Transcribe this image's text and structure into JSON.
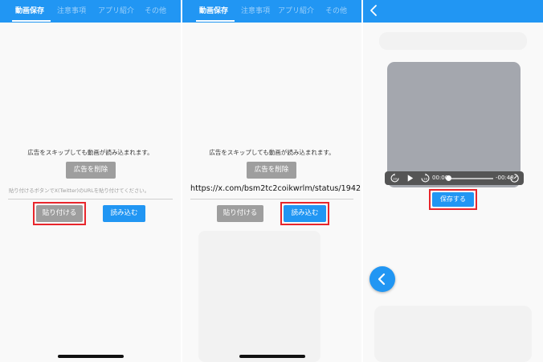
{
  "tabs": [
    "動画保存",
    "注意事項",
    "アプリ紹介",
    "その他"
  ],
  "notice": "広告をスキップしても動画が読み込まれます。",
  "remove_ad_label": "広告を削除",
  "url_placeholder": "貼り付けるボタンでX(Twitter)のURLを貼り付けてください。",
  "url_value": "https://x.com/bsm2tc2coikwrlm/status/1942",
  "paste_label": "貼り付ける",
  "load_label": "読み込む",
  "player": {
    "current_time": "00:00",
    "remaining_time": "-00:48",
    "progress": 0
  },
  "save_label": "保存する",
  "icons": {
    "back": "back-arrow-icon",
    "replay": "replay-10-icon",
    "play": "play-icon",
    "forward": "forward-10-icon",
    "speed": "playback-speed-icon",
    "fab": "chevron-left-icon"
  },
  "colors": {
    "primary": "#2196f3",
    "grey_button": "#9e9e9e",
    "highlight": "#e8262c"
  }
}
